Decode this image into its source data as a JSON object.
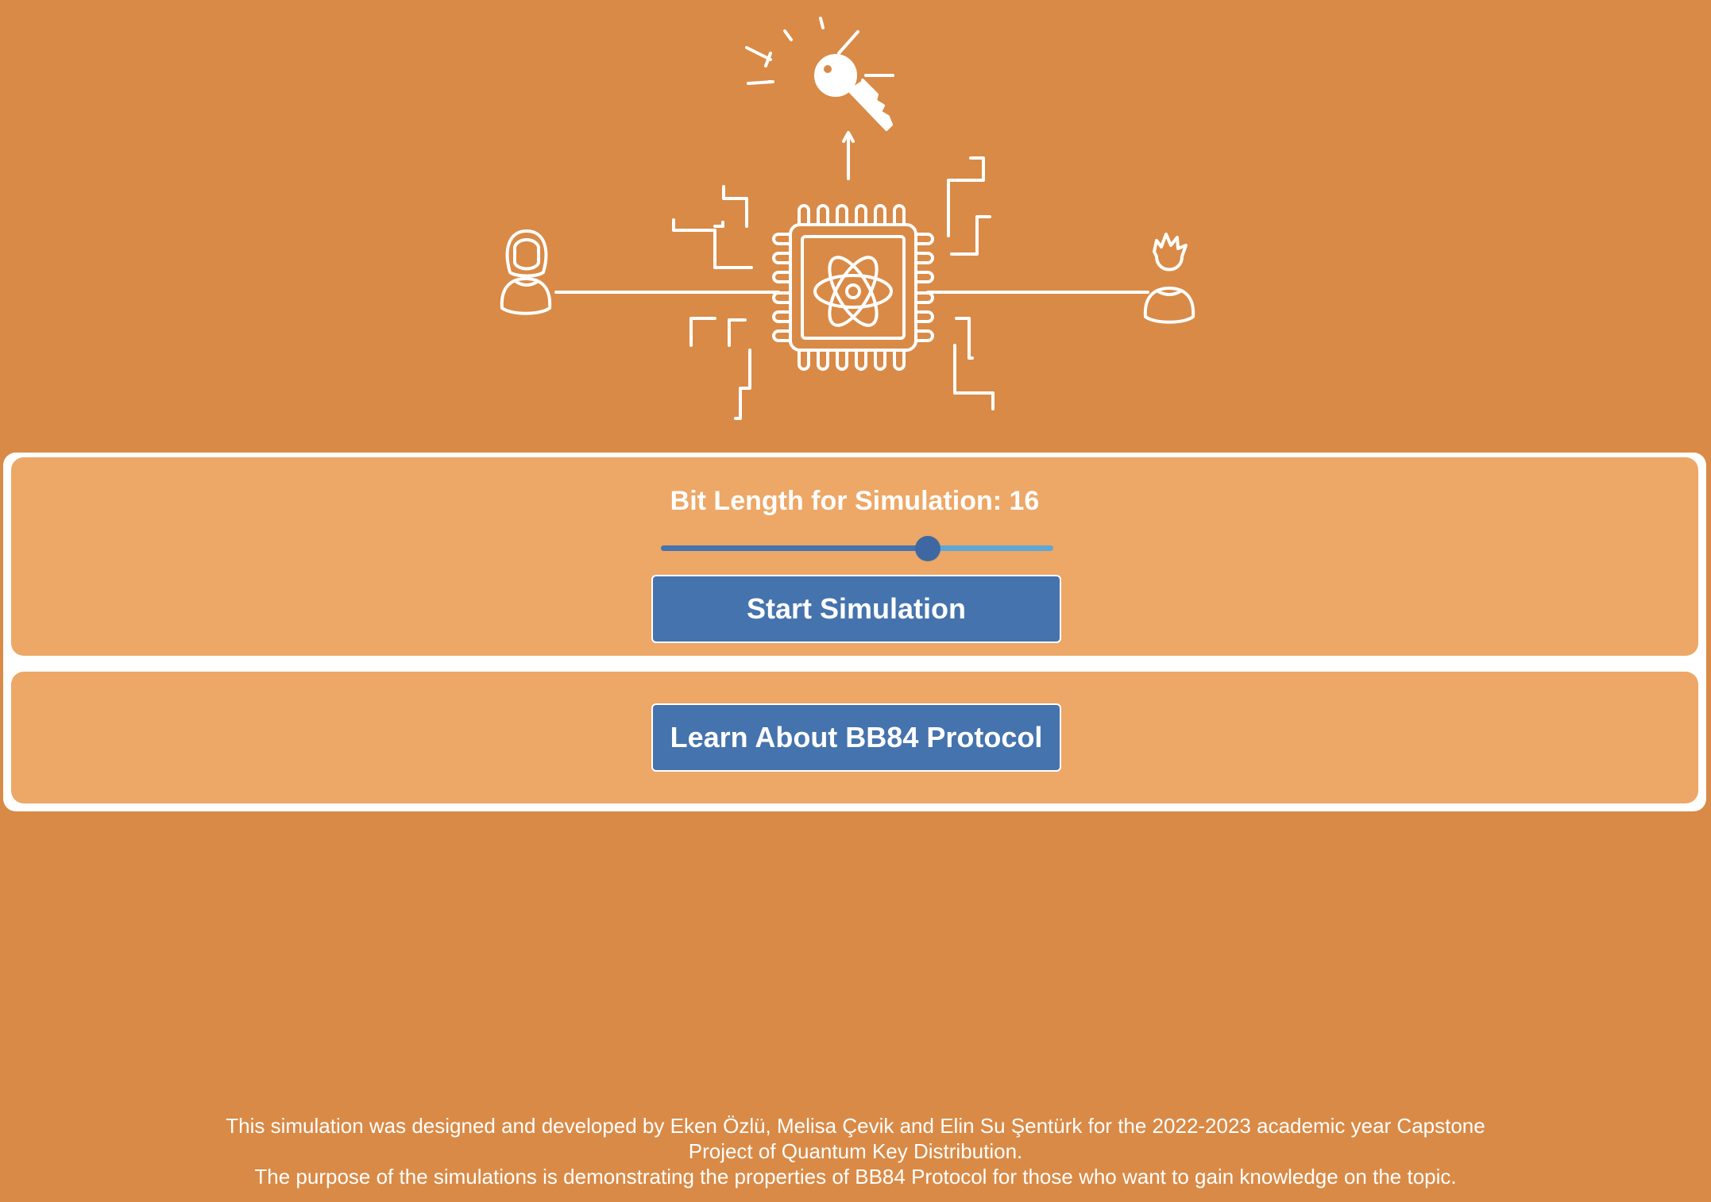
{
  "hero": {
    "icons": [
      "key-icon",
      "chip-icon",
      "atom-icon",
      "person-female-icon",
      "person-male-icon"
    ]
  },
  "simulation": {
    "bit_length_label": "Bit Length for Simulation: 16",
    "bit_length": 16,
    "slider_fraction": 0.68,
    "start_button_label": "Start Simulation"
  },
  "learn": {
    "button_label": "Learn About BB84 Protocol"
  },
  "footer": {
    "line1": "This simulation was designed and developed by Eken Özlü, Melisa Çevik and Elin Su Şentürk for the 2022-2023 academic year Capstone",
    "line2": "Project of Quantum Key Distribution.",
    "line3": "The purpose of the simulations is demonstrating the properties of BB84 Protocol for those who want to gain knowledge on the topic."
  },
  "colors": {
    "background": "#d98a46",
    "card": "#eda766",
    "button": "#4573ad",
    "slider_track": "#5ea7d6"
  }
}
